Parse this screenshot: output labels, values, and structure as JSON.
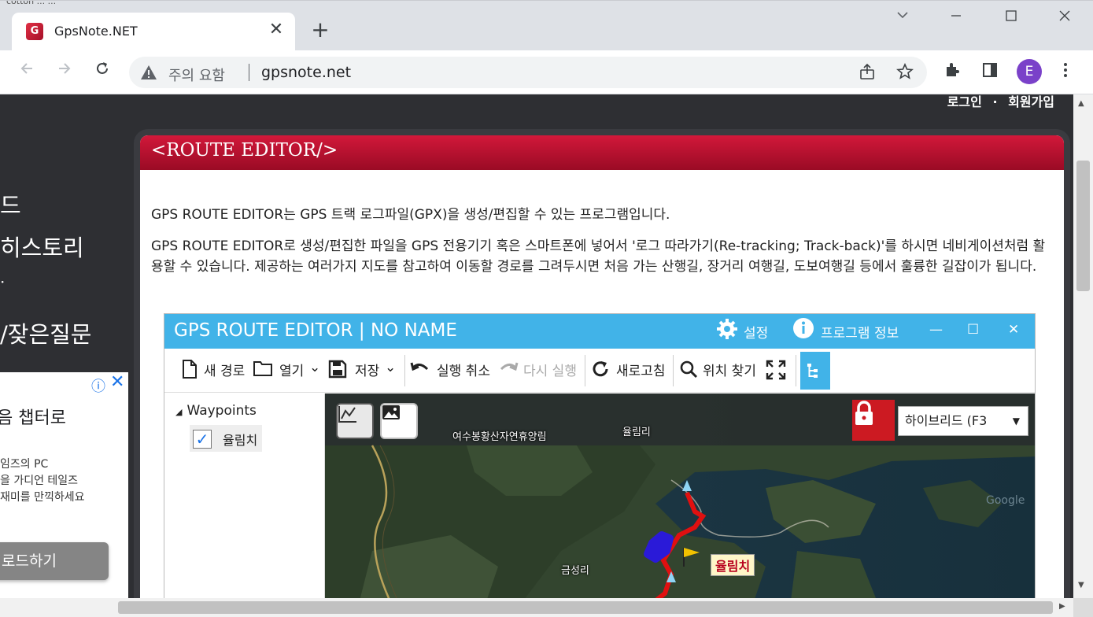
{
  "browser": {
    "tab_title": "GpsNote.NET",
    "tab_close": "✕",
    "new_tab": "+",
    "warning_text": "주의 요함",
    "url": "gpsnote.net",
    "avatar_letter": "E",
    "top_sliver_text": "cotton ... ..."
  },
  "header": {
    "login": "로그인",
    "separator": "·",
    "signup": "회원가입"
  },
  "sidebar": {
    "items": [
      {
        "label": "드"
      },
      {
        "label": "히스토리"
      },
      {
        "label": "·"
      },
      {
        "label": "/잦은질문"
      }
    ]
  },
  "ad": {
    "headline": "음 챕터로",
    "lines": [
      "임즈의 PC",
      "을 가디언 테일즈",
      "재미를 만끽하세요"
    ],
    "cta": "로드하기"
  },
  "panel": {
    "title": "<ROUTE EDITOR/>",
    "paragraph1": "GPS ROUTE EDITOR는 GPS 트랙 로그파일(GPX)을 생성/편집할 수 있는 프로그램입니다.",
    "paragraph2": "GPS ROUTE EDITOR로 생성/편집한 파일을 GPS 전용기기 혹은 스마트폰에 넣어서 '로그 따라가기(Re-tracking; Track-back)'를 하시면 네비게이션처럼 활용할 수 있습니다. 제공하는 여러가지 지도를 참고하여 이동할 경로를 그려두시면 처음 가는 산행길, 장거리 여행길, 도보여행길 등에서 훌륭한 길잡이가 됩니다."
  },
  "app": {
    "title": "GPS ROUTE EDITOR | NO NAME",
    "settings": "설정",
    "program_info": "프로그램 정보",
    "minimize": "—",
    "maximize": "☐",
    "close": "✕",
    "toolbar": {
      "new_route": "새 경로",
      "open": "열기",
      "save": "저장",
      "undo": "실행 취소",
      "redo": "다시 실행",
      "refresh": "새로고침",
      "find_location": "위치 찾기"
    },
    "waypoints_header": "Waypoints",
    "waypoint_item": "율림치",
    "map": {
      "type_select": "하이브리드 (F3",
      "labels": {
        "forest": "여수봉황산자연휴양림",
        "village_top": "율림리",
        "village_bottom": "금성리"
      },
      "marker_label": "율림치"
    }
  },
  "colors": {
    "panel_header": "#c4102f",
    "app_accent": "#41b3e8",
    "route": "#e01010",
    "route_edited": "#2a1ad8"
  },
  "icons": [
    "warning-icon",
    "share-icon",
    "star-icon",
    "extension-icon",
    "sidepanel-icon",
    "menu-icon",
    "back-icon",
    "forward-icon",
    "reload-icon",
    "gear-icon",
    "info-icon",
    "file-icon",
    "folder-icon",
    "save-icon",
    "undo-icon",
    "redo-icon",
    "refresh-icon",
    "search-icon",
    "expand-icon",
    "tree-icon",
    "chart-icon",
    "image-icon",
    "lock-icon",
    "flag-icon"
  ]
}
